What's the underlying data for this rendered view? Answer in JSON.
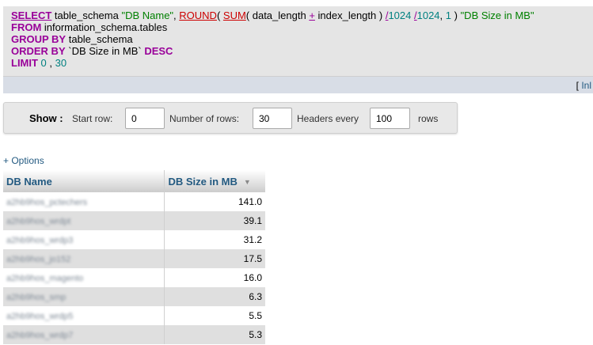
{
  "sql": {
    "line1": {
      "select": "SELECT",
      "col": " table_schema ",
      "alias1": "\"DB Name\"",
      "comma1": ", ",
      "round": "ROUND",
      "p1": "( ",
      "sum": "SUM",
      "p2": "( data_length ",
      "plus": "+",
      "p3": " index_length ) ",
      "div1": "/",
      "n1024a": "1024",
      "sp": " ",
      "div2": "/",
      "n1024b": "1024",
      "comma2": ", ",
      "one": "1",
      "p4": " ) ",
      "alias2": "\"DB Size in MB\""
    },
    "line2": {
      "kw": "FROM",
      "rest": " information_schema.tables"
    },
    "line3": {
      "kw": "GROUP BY",
      "rest": " table_schema"
    },
    "line4": {
      "kw": "ORDER BY",
      "rest": " `DB Size in MB` ",
      "kw2": "DESC"
    },
    "line5": {
      "kw": "LIMIT",
      "n0": " 0",
      "comma": " , ",
      "n30": "30"
    },
    "inline_link": {
      "bracket": "[ ",
      "label": "Inl"
    }
  },
  "show_bar": {
    "show_label": "Show :",
    "start_row_label": "Start row:",
    "start_row_value": "0",
    "num_rows_label": "Number of rows:",
    "num_rows_value": "30",
    "headers_every_label": "Headers every",
    "headers_every_value": "100",
    "rows_label": "rows"
  },
  "options_link": "+ Options",
  "table": {
    "columns": [
      "DB Name",
      "DB Size in MB"
    ],
    "sort_icon": "sort-desc-icon",
    "rows": [
      {
        "name": "a2hb9hos_pctechers",
        "size": "141.0"
      },
      {
        "name": "a2hb9hos_wrdpt",
        "size": "39.1"
      },
      {
        "name": "a2hb9hos_wrdp3",
        "size": "31.2"
      },
      {
        "name": "a2hb9hos_jo152",
        "size": "17.5"
      },
      {
        "name": "a2hb9hos_magento",
        "size": "16.0"
      },
      {
        "name": "a2hb9hos_smp",
        "size": "6.3"
      },
      {
        "name": "a2hb9hos_wrdp5",
        "size": "5.5"
      },
      {
        "name": "a2hb9hos_wrdp7",
        "size": "5.3"
      }
    ]
  },
  "colors": {
    "sql_bg": "#e5e5e5",
    "keyword": "#990099",
    "function": "#cc0000",
    "string": "#008000",
    "number": "#008080",
    "link": "#235a81",
    "row_even": "#dfdfdf"
  }
}
